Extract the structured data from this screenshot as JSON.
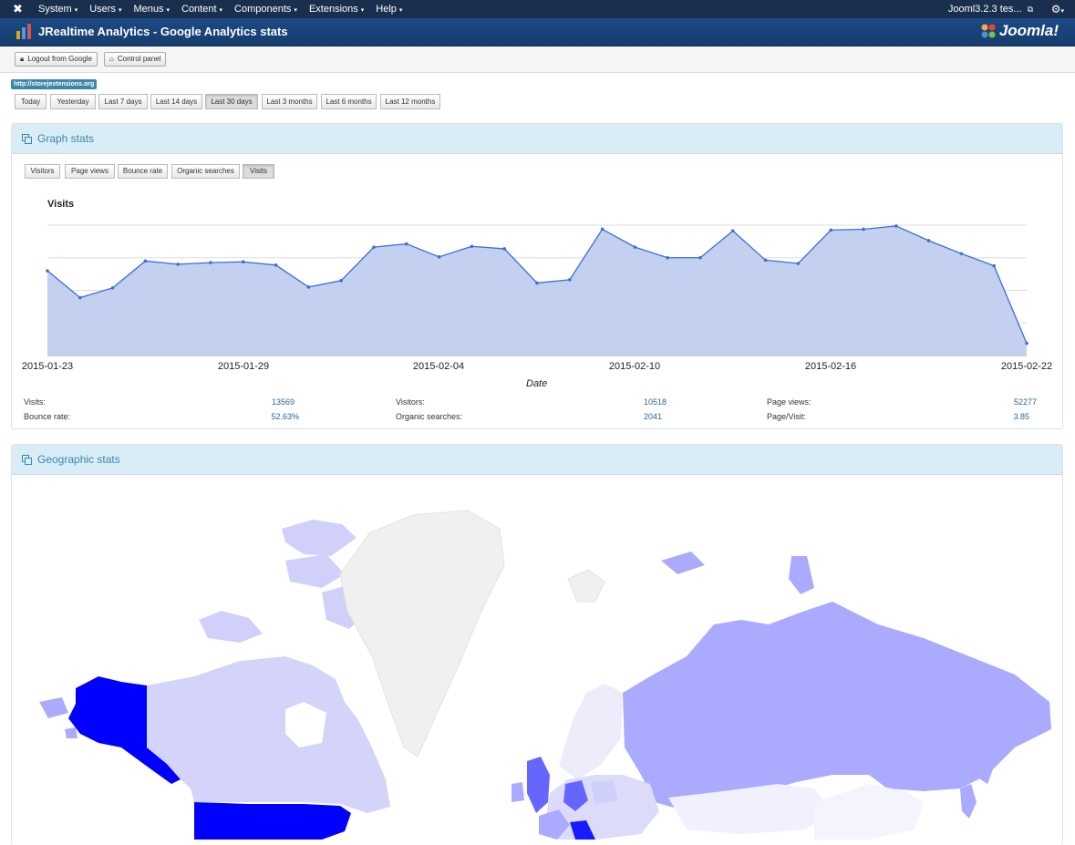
{
  "topnav": {
    "logo": "joomla-x-icon",
    "menu": [
      "System",
      "Users",
      "Menus",
      "Content",
      "Components",
      "Extensions",
      "Help"
    ],
    "site_name": "Jooml3.2.3 tes...",
    "gear": "gear-icon"
  },
  "header": {
    "title": "JRealtime Analytics - Google Analytics stats",
    "brand": "Joomla!"
  },
  "toolbar": {
    "logout_label": "Logout from Google",
    "control_panel_label": "Control panel"
  },
  "site_badge": "http://storejextensions.org",
  "ranges": [
    "Today",
    "Yesterday",
    "Last 7 days",
    "Last 14 days",
    "Last 30 days",
    "Last 3 months",
    "Last 6 months",
    "Last 12 months"
  ],
  "active_range": "Last 30 days",
  "graph_panel": {
    "title": "Graph stats",
    "metrics": [
      "Visitors",
      "Page views",
      "Bounce rate",
      "Organic searches",
      "Visits"
    ],
    "active_metric": "Visits"
  },
  "chart_data": {
    "type": "area",
    "title": "Visits",
    "xlabel": "Date",
    "ylabel": "",
    "x_ticks": [
      "2015-01-23",
      "2015-01-29",
      "2015-02-04",
      "2015-02-10",
      "2015-02-16",
      "2015-02-22"
    ],
    "ylim": [
      0,
      800
    ],
    "grid": true,
    "values": [
      520,
      355,
      415,
      580,
      560,
      570,
      575,
      555,
      420,
      460,
      665,
      685,
      605,
      670,
      655,
      445,
      465,
      775,
      665,
      600,
      600,
      765,
      585,
      565,
      770,
      775,
      795,
      705,
      625,
      550,
      75
    ],
    "color": "#3a6fd8",
    "fill": "#c3d0ef"
  },
  "stats": {
    "visits_label": "Visits:",
    "visits": "13569",
    "visitors_label": "Visitors:",
    "visitors": "10518",
    "pageviews_label": "Page views:",
    "pageviews": "52277",
    "bounce_label": "Bounce rate:",
    "bounce": "52.63%",
    "organic_label": "Organic searches:",
    "organic": "2041",
    "pagevisit_label": "Page/Visit:",
    "pagevisit": "3.85"
  },
  "geo_panel": {
    "title": "Geographic stats"
  },
  "colors": {
    "nav": "#1a2f4d",
    "header": "#1c4a85",
    "panel_head": "#d9edf7",
    "accent": "#3a87ad",
    "map_high": "#0000ff",
    "map_mid": "#aaaaff",
    "map_low": "#d4d4fa",
    "map_none": "#f2f2f2"
  }
}
